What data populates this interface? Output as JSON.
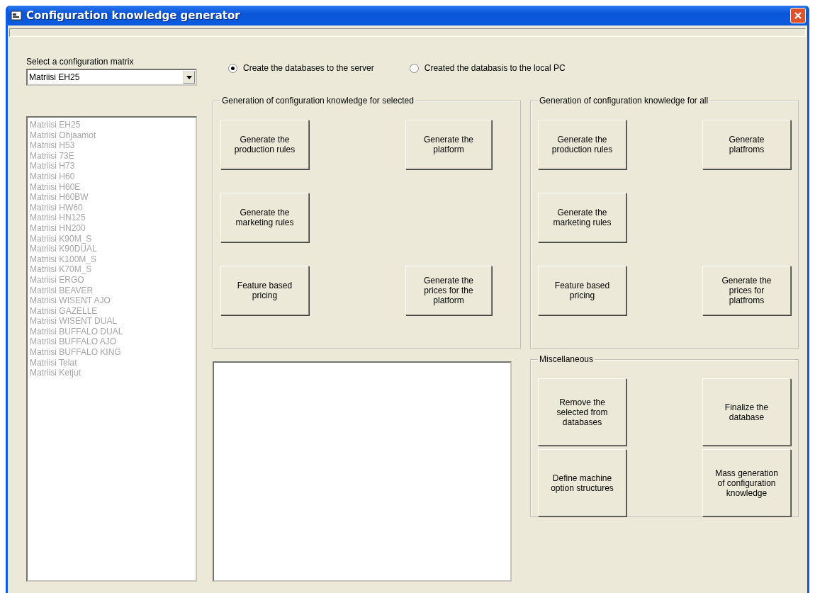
{
  "window": {
    "title": "Configuration knowledge generator"
  },
  "matrix_select": {
    "label": "Select a configuration matrix",
    "value": "Matriisi EH25"
  },
  "matrix_list": {
    "disabled": true,
    "items": [
      "Matriisi EH25",
      "Matriisi Ohjaamot",
      "Matriisi H53",
      "Matriisi 73E",
      "Matriisi H73",
      "Matriisi H60",
      "Matriisi H60E",
      "Matriisi H60BW",
      "Matriisi HW60",
      "Matriisi HN125",
      "Matriisi HN200",
      "Matriisi K90M_S",
      "Matriisi K90DUAL",
      "Matriisi K100M_S",
      "Matriisi K70M_S",
      "Matriisi ERGO",
      "Matriisi BEAVER",
      "Matriisi WISENT AJO",
      "Matriisi GAZELLE",
      "Matriisi WISENT DUAL",
      "Matriisi BUFFALO DUAL",
      "Matriisi BUFFALO AJO",
      "Matriisi BUFFALO KING",
      "Matriisi Telat",
      "Matriisi Ketjut"
    ]
  },
  "targets": [
    {
      "label": "Create the databases to the server",
      "selected": true
    },
    {
      "label": "Created the databasis to the local PC",
      "selected": false
    }
  ],
  "groups": [
    {
      "title": "Generation of configuration knowledge for selected",
      "rows": [
        [
          "Generate the production rules",
          "Generate the platform"
        ],
        [
          "Generate the marketing rules"
        ],
        [
          "Feature based pricing",
          "Generate the prices for the platform"
        ]
      ]
    },
    {
      "title": "Generation of configuration knowledge for all",
      "rows": [
        [
          "Generate the production rules",
          "Generate platfroms"
        ],
        [
          "Generate the marketing rules"
        ],
        [
          "Feature based pricing",
          "Generate the prices for platfroms"
        ]
      ]
    }
  ],
  "miscellaneous": {
    "title": "Miscellaneous",
    "rows": [
      [
        "Remove the selected from databases",
        "Finalize the database"
      ],
      [
        "Define machine option structures",
        "Mass generation of configuration knowledge"
      ]
    ]
  }
}
